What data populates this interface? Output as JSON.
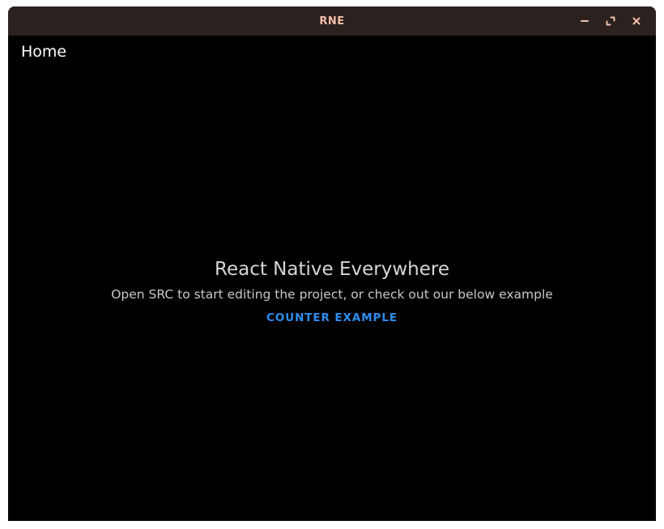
{
  "window": {
    "title": "RNE",
    "controls": {
      "minimize": "minimize-icon",
      "maximize": "maximize-icon",
      "close": "close-icon"
    }
  },
  "header": {
    "title": "Home"
  },
  "main": {
    "headline": "React Native Everywhere",
    "subtitle": "Open SRC to start editing the project, or check out our below example",
    "button_label": "COUNTER EXAMPLE"
  },
  "colors": {
    "titlebar": "#2b211e",
    "title_text": "#f3bfa8",
    "background": "#000000",
    "link": "#2d8ef0"
  }
}
